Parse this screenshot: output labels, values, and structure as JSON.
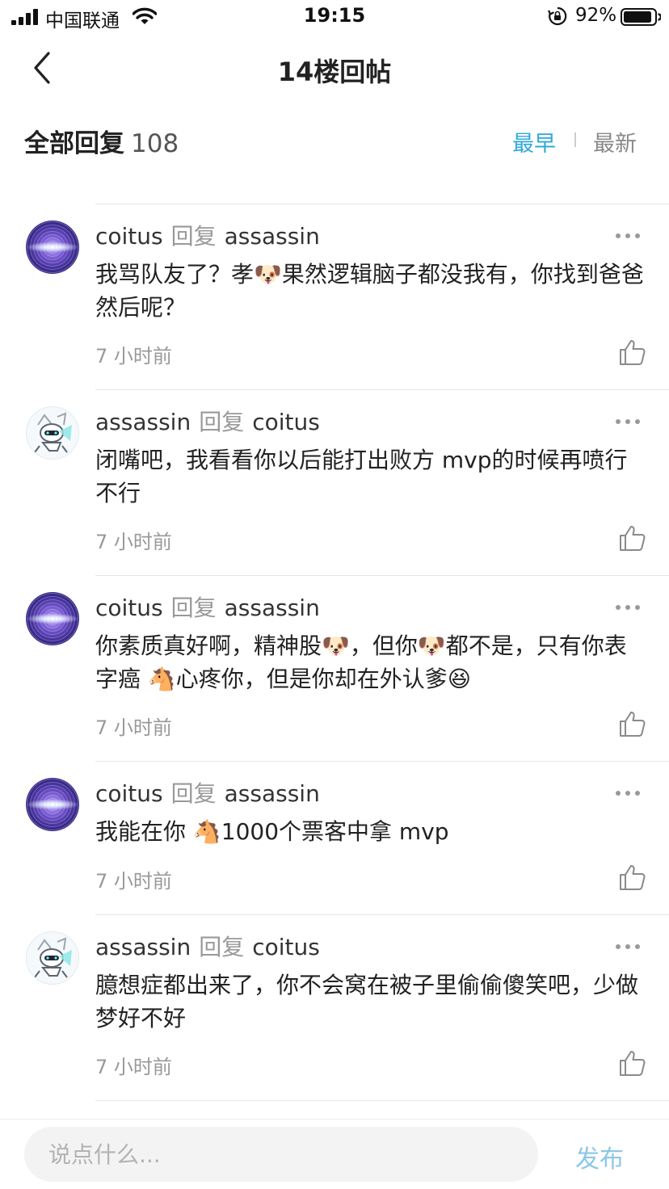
{
  "status_bar": {
    "carrier": "中国联通",
    "time": "19:15",
    "battery_percent": "92%",
    "battery_level": 0.92
  },
  "nav": {
    "title": "14楼回帖",
    "back_icon": "chevron-left-icon"
  },
  "filter": {
    "label": "全部回复",
    "count": "108",
    "sort_options": [
      "最早",
      "最新"
    ],
    "active_sort": "最早",
    "active_color": "#2ea8d9"
  },
  "replies": [
    {
      "author": "coitus",
      "reply_word": "回复",
      "target": "assassin",
      "avatar": "purple-orb-avatar",
      "content": "我骂队友了？孝🐶果然逻辑脑子都没我有，你找到爸爸然后呢？",
      "time": "7 小时前"
    },
    {
      "author": "assassin",
      "reply_word": "回复",
      "target": "coitus",
      "avatar": "robot-avatar",
      "content": "闭嘴吧，我看看你以后能打出败方 mvp的时候再喷行不行",
      "time": "7 小时前"
    },
    {
      "author": "coitus",
      "reply_word": "回复",
      "target": "assassin",
      "avatar": "purple-orb-avatar",
      "content": "你素质真好啊，精神股🐶，但你🐶都不是，只有你表字癌 🐴心疼你，但是你却在外认爹😆",
      "time": "7 小时前"
    },
    {
      "author": "coitus",
      "reply_word": "回复",
      "target": "assassin",
      "avatar": "purple-orb-avatar",
      "content": "我能在你 🐴1000个票客中拿 mvp",
      "time": "7 小时前"
    },
    {
      "author": "assassin",
      "reply_word": "回复",
      "target": "coitus",
      "avatar": "robot-avatar",
      "content": "臆想症都出来了，你不会窝在被子里偷偷傻笑吧，少做梦好不好",
      "time": "7 小时前"
    }
  ],
  "composer": {
    "placeholder": "说点什么...",
    "publish_label": "发布"
  }
}
